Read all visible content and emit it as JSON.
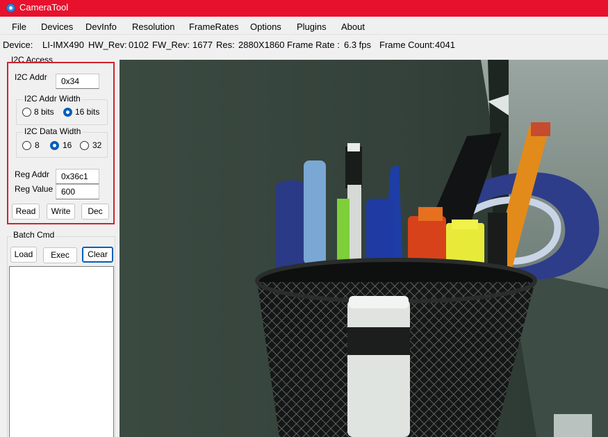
{
  "window": {
    "title": "CameraTool",
    "icon": "camera-app-icon",
    "titlebar_color": "#e8112d"
  },
  "menu": {
    "items": [
      {
        "label": "File"
      },
      {
        "label": "Devices"
      },
      {
        "label": "DevInfo"
      },
      {
        "label": "Resolution"
      },
      {
        "label": "FrameRates"
      },
      {
        "label": "Options"
      },
      {
        "label": "Plugins"
      },
      {
        "label": "About"
      }
    ]
  },
  "info": {
    "device_label": "Device:",
    "device": "LI-IMX490",
    "hw_label": "HW_Rev:",
    "hw": "0102",
    "fw_label": "FW_Rev:",
    "fw": "1677",
    "res_label": "Res:",
    "res": "2880X1860",
    "framerate_label": "Frame Rate :",
    "framerate": "6.3 fps",
    "framecount_label": "Frame Count:",
    "framecount": "4041"
  },
  "i2c": {
    "group_title": "I2C Access",
    "addr_label": "I2C Addr",
    "addr_value": "0x34",
    "addr_width": {
      "title": "I2C Addr Width",
      "options": [
        {
          "label": "8 bits",
          "checked": false
        },
        {
          "label": "16 bits",
          "checked": true
        }
      ]
    },
    "data_width": {
      "title": "I2C Data Width",
      "options": [
        {
          "label": "8",
          "checked": false
        },
        {
          "label": "16",
          "checked": true
        },
        {
          "label": "32",
          "checked": false
        }
      ]
    },
    "reg_addr_label": "Reg Addr",
    "reg_addr_value": "0x36c1",
    "reg_value_label": "Reg Value",
    "reg_value_value": "600",
    "buttons": {
      "read": "Read",
      "write": "Write",
      "dec": "Dec"
    },
    "highlight_color": "#d4202f"
  },
  "batch": {
    "group_title": "Batch Cmd",
    "buttons": {
      "load": "Load",
      "exec": "Exec",
      "clear": "Clear"
    }
  },
  "accent_color": "#005fb8"
}
